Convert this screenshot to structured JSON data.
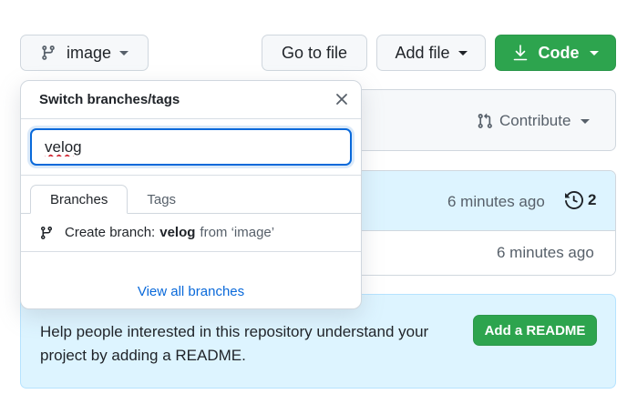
{
  "toolbar": {
    "branch_label": "image",
    "goto_file_label": "Go to file",
    "add_file_label": "Add file",
    "code_label": "Code"
  },
  "contribute": {
    "label": "Contribute"
  },
  "commit_panel": {
    "time": "6 minutes ago",
    "history_count": "2",
    "row_time": "6 minutes ago"
  },
  "branch_dropdown": {
    "title": "Switch branches/tags",
    "filter_value": "velog",
    "tabs": [
      "Branches",
      "Tags"
    ],
    "create_prefix": "Create branch:",
    "create_name": "velog",
    "create_suffix": "from ‘image’",
    "view_all_label": "View all branches"
  },
  "readme": {
    "message": "Help people interested in this repository understand your project by adding a README.",
    "button_label": "Add a README"
  },
  "colors": {
    "accent": "#0969da",
    "green": "#2da44e",
    "readme_bg": "#ddf4ff"
  }
}
